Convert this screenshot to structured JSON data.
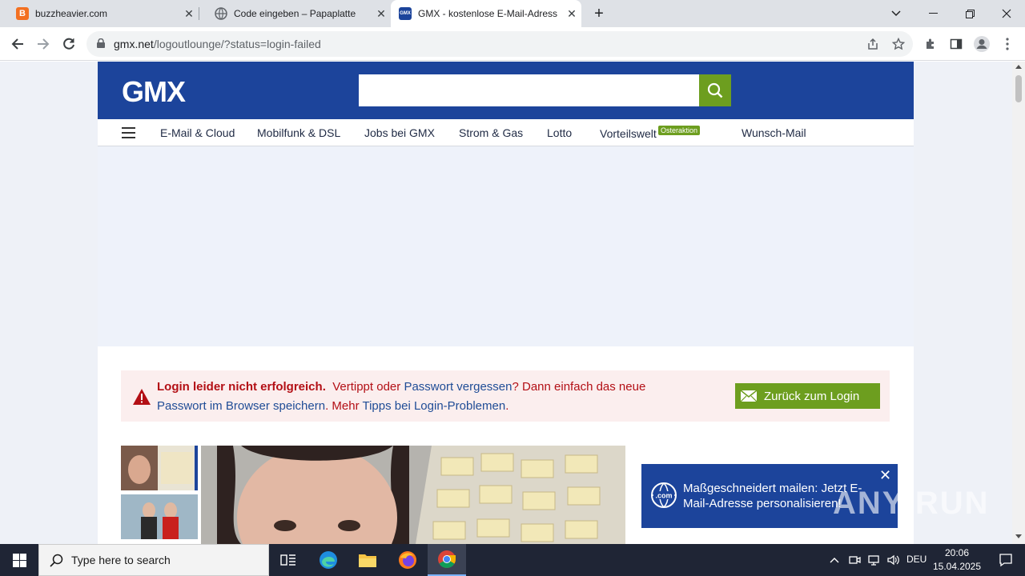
{
  "browser": {
    "tabs": [
      {
        "title": "buzzheavier.com",
        "favicon": "b-icon"
      },
      {
        "title": "Code eingeben – Papaplatte",
        "favicon": "globe-icon"
      },
      {
        "title": "GMX - kostenlose E-Mail-Adress",
        "favicon": "gmx-icon"
      }
    ],
    "url_host": "gmx.net",
    "url_path": "/logoutlounge/?status=login-failed"
  },
  "site": {
    "logo": "GMX",
    "search_placeholder": "",
    "nav": [
      "E-Mail & Cloud",
      "Mobilfunk & DSL",
      "Jobs bei GMX",
      "Strom & Gas",
      "Lotto",
      "Vorteilswelt",
      "Wunsch-Mail"
    ],
    "nav_badge": "Osteraktion",
    "error": {
      "bold": "Login leider nicht erfolgreich.",
      "part1": "Vertippt oder ",
      "link1": "Passwort vergessen",
      "part2": "? Dann einfach das neue ",
      "link2": "Passwort im Browser speichern",
      "part3": ". Mehr ",
      "link3": "Tipps bei Login-Problemen",
      "part4": "."
    },
    "login_button": "Zurück zum Login",
    "popup_text": "Maßgeschneidert mailen: Jetzt E-Mail-Adresse personalisieren!"
  },
  "taskbar": {
    "search_placeholder": "Type here to search",
    "language": "DEU",
    "time": "20:06",
    "date": "15.04.2025"
  },
  "watermark": "ANY RUN",
  "colors": {
    "gmx_blue": "#1c449b",
    "gmx_green": "#6d9e1f",
    "error_red": "#b30f15",
    "error_bg": "#fbeeee"
  }
}
